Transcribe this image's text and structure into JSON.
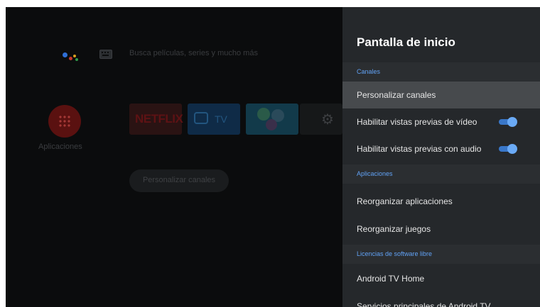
{
  "home": {
    "search_hint": "Busca películas, series y mucho más",
    "apps_label": "Aplicaciones",
    "tiles": {
      "netflix": "NETFLIX",
      "tv": "TV"
    },
    "pill_label": "Personalizar canales"
  },
  "panel": {
    "title": "Pantalla de inicio",
    "sections": {
      "channels": "Canales",
      "apps": "Aplicaciones",
      "licenses": "Licencias de software libre"
    },
    "items": {
      "customize_channels": "Personalizar canales",
      "video_previews": "Habilitar vistas previas de vídeo",
      "audio_previews": "Habilitar vistas previas con audio",
      "reorder_apps": "Reorganizar aplicaciones",
      "reorder_games": "Reorganizar juegos",
      "android_tv_home": "Android TV Home",
      "core_services": "Servicios principales de Android TV"
    },
    "toggles": {
      "video_previews": true,
      "audio_previews": true
    }
  },
  "colors": {
    "panel_bg": "#25282b",
    "accent": "#61a2f5",
    "focus_row": "#474a4d"
  },
  "icons": [
    "google-assistant-icon",
    "keyboard-icon",
    "apps-grid-icon",
    "tv-icon",
    "settings-gear-icon"
  ]
}
